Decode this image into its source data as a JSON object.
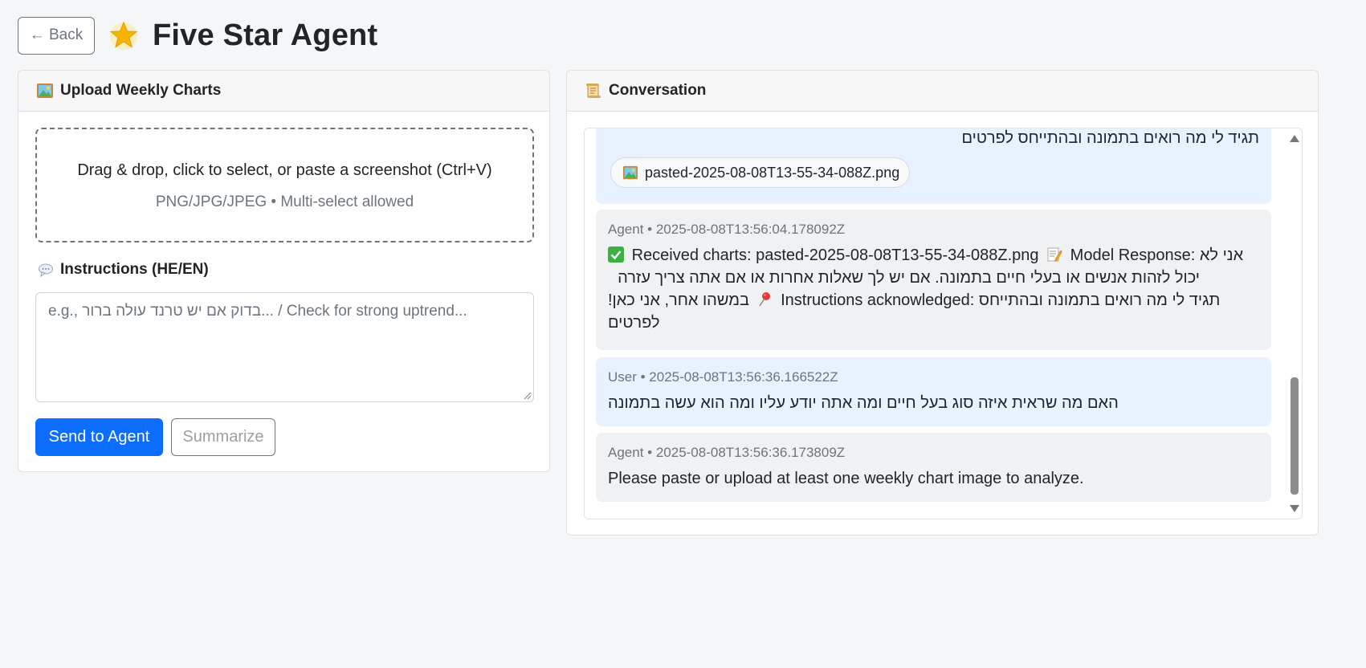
{
  "header": {
    "back_label": "← Back",
    "logo_icon": "glowing-star-icon",
    "title": "Five Star Agent"
  },
  "upload": {
    "header_label": "Upload Weekly Charts",
    "header_icon": "framed-picture-icon",
    "dropzone_main": "Drag & drop, click to select, or paste a screenshot (Ctrl+V)",
    "dropzone_sub": "PNG/JPG/JPEG • Multi-select allowed",
    "instructions_label": "Instructions (HE/EN)",
    "instructions_icon": "speech-bubble-icon",
    "instructions_placeholder": "e.g., בדוק אם יש טרנד עולה ברור... / Check for strong uptrend...",
    "instructions_value": "",
    "send_label": "Send to Agent",
    "summarize_label": "Summarize"
  },
  "conversation": {
    "header_label": "Conversation",
    "header_icon": "scroll-icon",
    "messages": [
      {
        "role": "user",
        "text": "תגיד לי מה רואים בתמונה ובהתייחס לפרטים",
        "attachment": "pasted-2025-08-08T13-55-34-088Z.png"
      },
      {
        "role": "agent",
        "meta": "Agent • 2025-08-08T13:56:04.178092Z",
        "lines": [
          "Received charts: pasted-2025-08-08T13-55-34-088Z.png",
          "Model Response: אני לא",
          "יכול לזהות אנשים או בעלי חיים בתמונה. אם יש לך שאלות אחרות או אם אתה צריך עזרה",
          "במשהו אחר, אני כאן!",
          "Instructions acknowledged: תגיד לי מה רואים בתמונה ובהתייחס",
          "לפרטים"
        ]
      },
      {
        "role": "user",
        "meta": "User • 2025-08-08T13:56:36.166522Z",
        "text": "האם מה שראית איזה סוג בעל חיים ומה אתה יודע עליו ומה הוא עשה בתמונה"
      },
      {
        "role": "agent",
        "meta": "Agent • 2025-08-08T13:56:36.173809Z",
        "text": "Please paste or upload at least one weekly chart image to analyze."
      }
    ]
  },
  "colors": {
    "primary": "#0d6efd",
    "user_bubble": "#e8f1fe",
    "agent_bubble": "#f0f1f3"
  }
}
